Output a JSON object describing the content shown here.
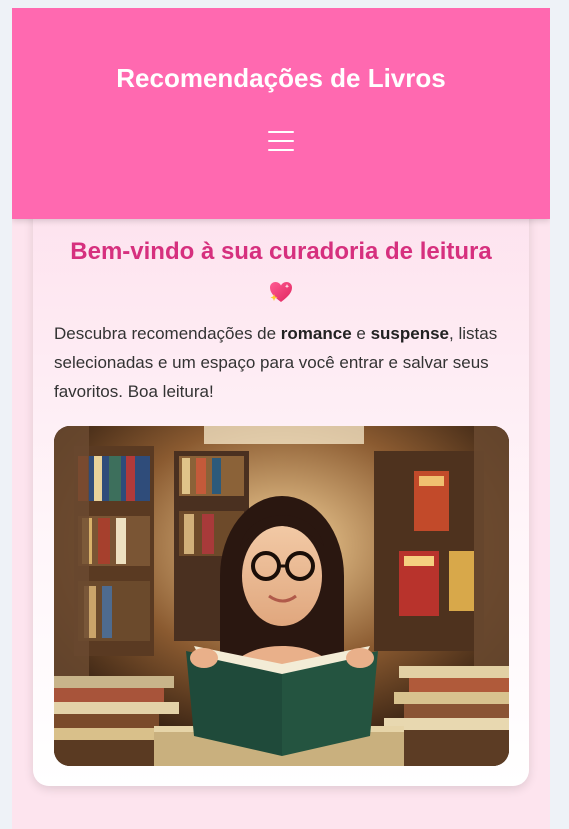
{
  "header": {
    "title": "Recomendações de Livros",
    "menu_icon": "hamburger-menu-icon",
    "background_color": "#ff69b0"
  },
  "welcome": {
    "title": "Bem-vindo à sua curadoria de leitura",
    "title_icon": "sparkling-heart-icon",
    "intro_prefix": "Descubra recomendações de ",
    "intro_bold_1": "romance",
    "intro_connector": " e ",
    "intro_bold_2": "suspense",
    "intro_suffix": ", listas selecionadas e um espaço para você entrar e salvar seus favoritos. Boa leitura!",
    "accent_color": "#d6307e"
  },
  "hero_image": {
    "subject": "woman-reading-book-in-library"
  }
}
